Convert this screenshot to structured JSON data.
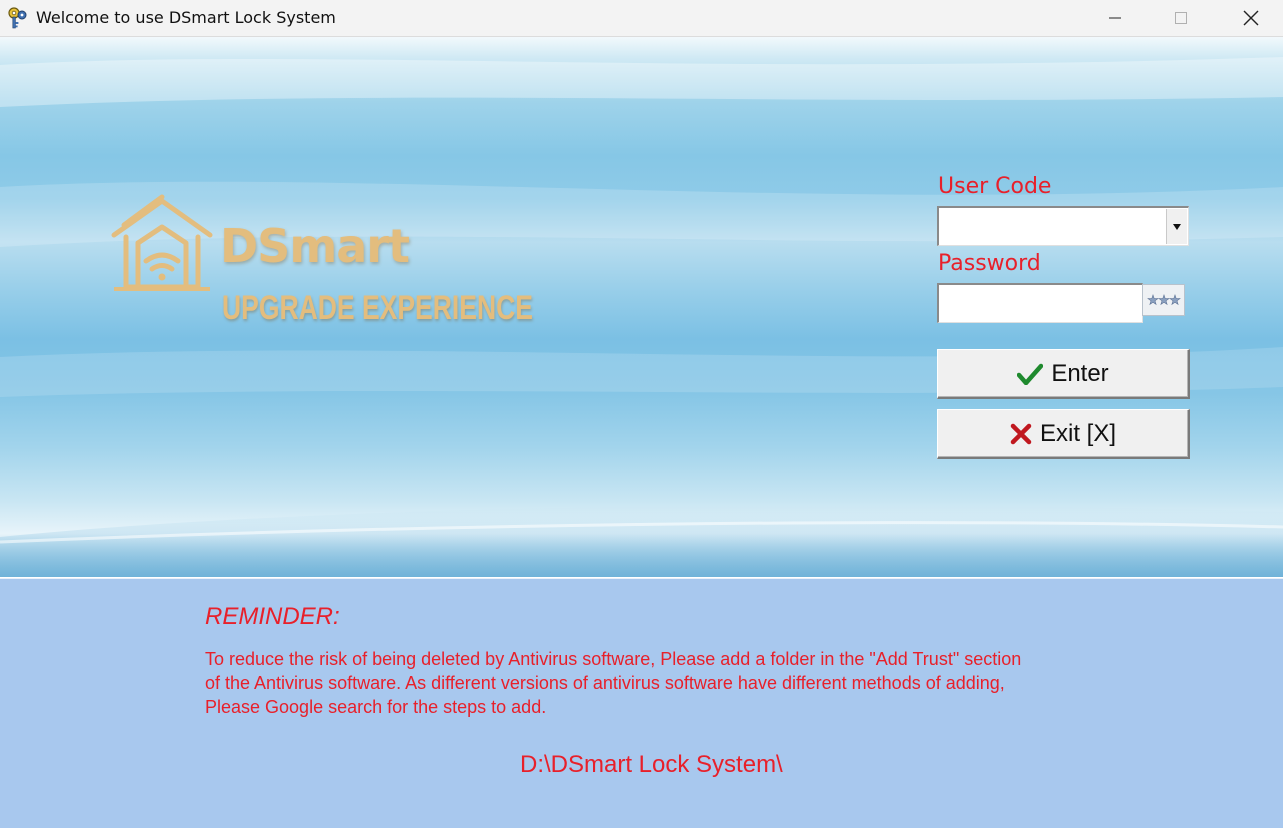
{
  "window": {
    "title": "Welcome to use DSmart Lock System"
  },
  "brand": {
    "name": "DSmart",
    "tagline": "UPGRADE EXPERIENCE",
    "color": "#e3bd7e"
  },
  "login": {
    "user_code_label": "User Code",
    "user_code_value": "",
    "password_label": "Password",
    "password_value": "",
    "enter_label": "Enter",
    "exit_label": "Exit [X]",
    "label_color": "#e8202a"
  },
  "reminder": {
    "title": "REMINDER:",
    "lines": [
      " To reduce the risk of being deleted by Antivirus software, Please add a folder in the \"Add Trust\" section",
      "of the Antivirus software. As different versions of antivirus software have different methods of adding,",
      "Please Google search for the steps to add."
    ],
    "path": "D:\\DSmart Lock System\\",
    "panel_color": "#a8c8ee"
  },
  "icons": {
    "app": "key-icon",
    "logo": "smart-home-wifi-icon",
    "enter": "checkmark-icon",
    "exit": "x-mark-icon",
    "password_toggle": "asterisks-icon",
    "combo": "dropdown-arrow-icon"
  }
}
